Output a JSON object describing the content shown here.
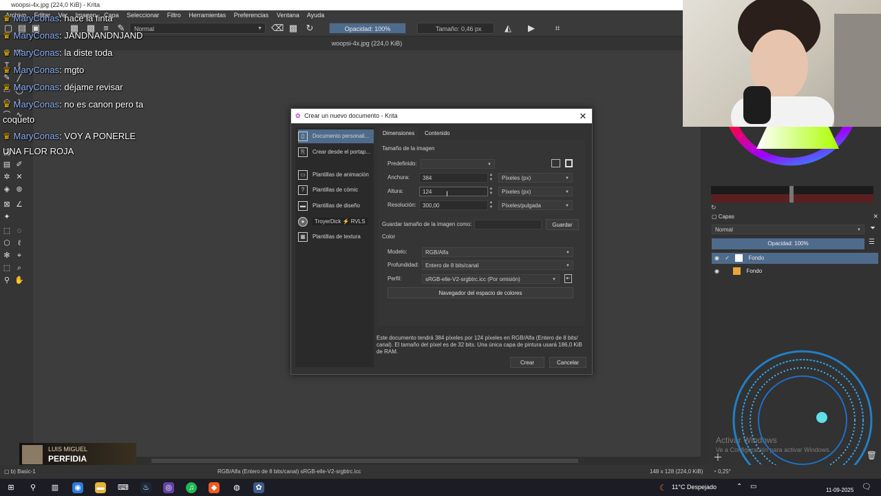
{
  "window": {
    "title": "woopsi-4x.jpg (224,0 KiB) - Krita"
  },
  "menu": [
    "Archivo",
    "Editar",
    "Ver",
    "Imagen",
    "Capa",
    "Seleccionar",
    "Filtro",
    "Herramientas",
    "Preferencias",
    "Ventana",
    "Ayuda"
  ],
  "toolbar": {
    "blend_mode": "Normal",
    "opacity": "Opacidad: 100%",
    "size": "Tamaño: 0,46 px"
  },
  "document_tab": "woopsi-4x.jpg (224,0 KiB)",
  "chat": [
    {
      "user": "MaryConas",
      "text": "hace la finta"
    },
    {
      "user": "MaryConas",
      "text": "JANDNANDNJAND"
    },
    {
      "user": "MaryConas",
      "text": "la diste toda"
    },
    {
      "user": "MaryConas",
      "text": "mgto"
    },
    {
      "user": "MaryConas",
      "text": "déjame revisar"
    },
    {
      "user": "MaryConas",
      "text": "no es canon pero ta"
    },
    {
      "user": "",
      "text": "coqueto"
    },
    {
      "user": "MaryConas",
      "text": "VOY A PONERLE"
    },
    {
      "user": "",
      "text": "UNA FLOR ROJA"
    }
  ],
  "dialog": {
    "title": "Crear un nuevo documento - Krita",
    "sidebar": [
      {
        "label": "Documento personali...",
        "icon": "doc-icon",
        "glyph": "▯",
        "active": true
      },
      {
        "label": "Crear desde el portap...",
        "icon": "clipboard-icon",
        "glyph": "⎘",
        "active": false
      },
      {
        "label": "Plantillas de animación",
        "icon": "film-icon",
        "glyph": "▭",
        "active": false
      },
      {
        "label": "Plantillas de cómic",
        "icon": "speech-bubble-icon",
        "glyph": "?",
        "active": false
      },
      {
        "label": "Plantillas de diseño",
        "icon": "design-icon",
        "glyph": "▬",
        "active": false
      },
      {
        "label": "TroyerDick ⚡ RVLS",
        "icon": "avatar-icon",
        "glyph": "●",
        "active": false
      },
      {
        "label": "Plantillas de textura",
        "icon": "texture-icon",
        "glyph": "▦",
        "active": false
      }
    ],
    "tabs": [
      "Dimensiones",
      "Contenido"
    ],
    "size_section": "Tamaño de la imagen",
    "predefined_label": "Predefinido:",
    "predefined_value": "",
    "width_label": "Anchura:",
    "width_value": "384",
    "width_unit": "Píxeles (px)",
    "height_label": "Altura:",
    "height_value": "124",
    "height_unit": "Píxeles (px)",
    "resolution_label": "Resolución:",
    "resolution_value": "300,00",
    "resolution_unit": "Píxeles/pulgada",
    "save_size_label": "Guardar tamaño de la imagen como:",
    "save_size_value": "",
    "save_button": "Guardar",
    "color_section": "Color",
    "model_label": "Modelo:",
    "model_value": "RGB/Alfa",
    "depth_label": "Profundidad:",
    "depth_value": "Entero de 8 bits/canal",
    "profile_label": "Perfil:",
    "profile_value": "sRGB-elle-V2-srgbtrc.icc (Por omisión)",
    "colorspace_button": "Navegador del espacio de colores",
    "info": "Este documento tendrá 384 píxeles por 124 píxeles en RGB/Alfa (Entero de 8 bits/ canal). El tamaño del píxel es de 32 bits. Una única capa de pintura usará 186,0 KiB de RAM.",
    "create_button": "Crear",
    "cancel_button": "Cancelar"
  },
  "layers": {
    "title": "Capas",
    "blend_mode": "Normal",
    "opacity": "Opacidad: 100%",
    "items": [
      "Fondo",
      "Fondo"
    ]
  },
  "statusbar": {
    "brush": "b) Basic-1",
    "colorspace": "RGB/Alfa (Entero de 8 bits/canal)  sRGB-elle-V2-srgbtrc.icc",
    "image_size": "148 x 128 (224,0 KiB)",
    "zoom": "0,25°"
  },
  "activation": {
    "line1": "Activar Windows",
    "line2": "Ve a Configuración para activar Windows."
  },
  "now_playing": {
    "artist": "LUIS MIGUEL",
    "song": "PERFIDIA"
  },
  "taskbar": {
    "weather": "11°C  Despejado",
    "time": "",
    "date": "11-09-2025"
  }
}
